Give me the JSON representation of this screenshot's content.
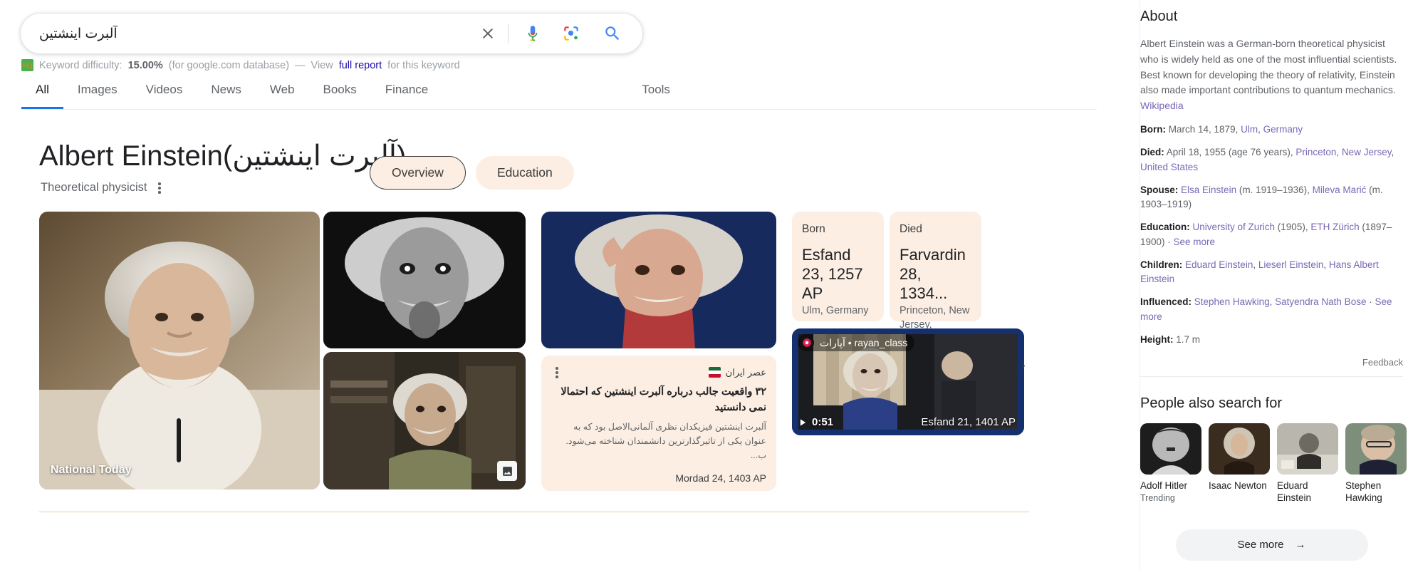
{
  "search": {
    "query": "آلبرت اینشتین",
    "icons": {
      "clear": "close-icon",
      "mic": "microphone-icon",
      "lens": "google-lens-icon",
      "go": "search-icon"
    }
  },
  "keyword_difficulty": {
    "badge": "SQ",
    "label": "Keyword difficulty:",
    "value": "15.00%",
    "database": "(for google.com database)",
    "dash": "—",
    "view": "View",
    "link": "full report",
    "tail": "for this keyword"
  },
  "nav": {
    "tabs": [
      {
        "label": "All",
        "active": true
      },
      {
        "label": "Images",
        "active": false
      },
      {
        "label": "Videos",
        "active": false
      },
      {
        "label": "News",
        "active": false
      },
      {
        "label": "Web",
        "active": false
      },
      {
        "label": "Books",
        "active": false
      },
      {
        "label": "Finance",
        "active": false
      }
    ],
    "tools": "Tools"
  },
  "knowledge_panel": {
    "title": "Albert Einstein(آلبرت اینشتین)",
    "subtitle": "Theoretical physicist",
    "tabs": [
      {
        "label": "Overview",
        "selected": true
      },
      {
        "label": "Education",
        "selected": false
      }
    ]
  },
  "media": {
    "big_photo_caption": "National Today",
    "news": {
      "source": "عصر ایران",
      "title": "۳۲ واقعیت جالب درباره آلبرت اینشتین که احتمالا نمی دانستید",
      "snippet": "آلبرت اینشتین فیزیکدان نظری آلمانی‌الاصل بود که به عنوان یکی از تاثیرگذارترین دانشمندان شناخته می‌شود. ب...",
      "date": "Mordad 24, 1403 AP"
    },
    "video": {
      "source": "آپارات • rayan_class",
      "duration": "0:51",
      "date": "Esfand 21, 1401 AP"
    },
    "facts": [
      {
        "label": "Born",
        "value": "Esfand 23, 1257 AP",
        "sub": "Ulm, Germany"
      },
      {
        "label": "Died",
        "value": "Farvardin 28, 1334...",
        "sub": "Princeton, New Jersey, United..."
      }
    ]
  },
  "about": {
    "heading": "About",
    "description": "Albert Einstein was a German-born theoretical physicist who is widely held as one of the most influential scientists. Best known for developing the theory of relativity, Einstein also made important contributions to quantum mechanics.",
    "source_link": "Wikipedia",
    "facts": [
      {
        "key": "Born:",
        "value": "March 14, 1879, ",
        "links": [
          "Ulm",
          "Germany"
        ]
      },
      {
        "key": "Died:",
        "value": "April 18, 1955 (age 76 years), ",
        "links": [
          "Princeton",
          "New Jersey",
          "United States"
        ]
      },
      {
        "key": "Spouse:",
        "value": "",
        "links": [
          "Elsa Einstein"
        ],
        "mid": " (m. 1919–1936), ",
        "links2": [
          "Mileva Marić"
        ],
        "tail": " (m. 1903–1919)"
      },
      {
        "key": "Education:",
        "value": "",
        "links": [
          "University of Zurich"
        ],
        "mid": " (1905), ",
        "links2": [
          "ETH Zürich"
        ],
        "tail": " (1897–1900) · ",
        "more": "See more"
      },
      {
        "key": "Children:",
        "value": "",
        "links": [
          "Eduard Einstein",
          "Lieserl Einstein",
          "Hans Albert Einstein"
        ]
      },
      {
        "key": "Influenced:",
        "value": "",
        "links": [
          "Stephen Hawking",
          "Satyendra Nath Bose"
        ],
        "tail": " · ",
        "more": "See more"
      },
      {
        "key": "Height:",
        "value": "1.7 m",
        "links": []
      }
    ],
    "feedback": "Feedback"
  },
  "people_also_search": {
    "heading": "People also search for",
    "items": [
      {
        "name": "Adolf Hitler",
        "note": "Trending"
      },
      {
        "name": "Isaac Newton",
        "note": ""
      },
      {
        "name": "Eduard Einstein",
        "note": ""
      },
      {
        "name": "Stephen Hawking",
        "note": ""
      }
    ],
    "see_more": "See more"
  },
  "colors": {
    "accent_card": "#fceee3",
    "link": "#7b68b5",
    "tab_active": "#1a73e8",
    "divider": "#e8c9aa"
  }
}
